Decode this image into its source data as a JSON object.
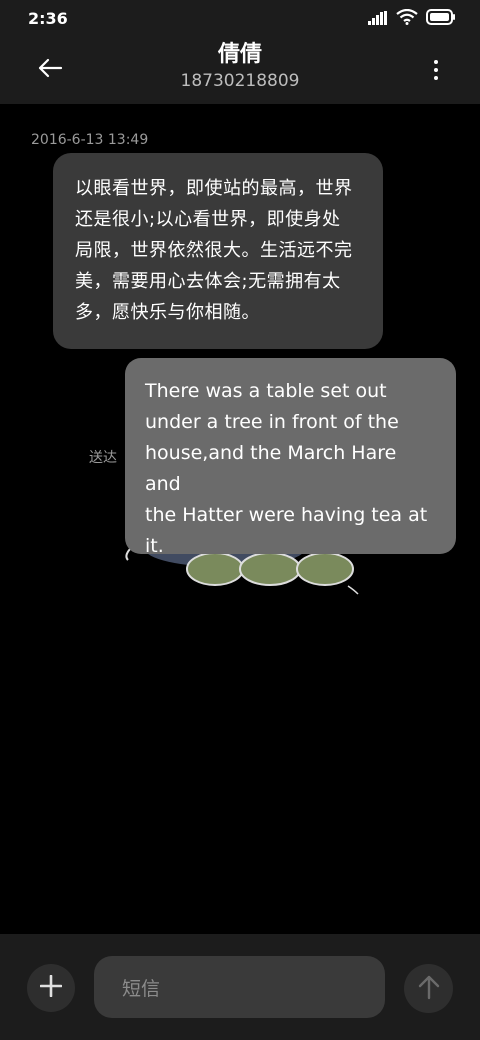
{
  "status_bar": {
    "time": "2:36",
    "icons": [
      "signal-icon",
      "wifi-icon",
      "battery-icon"
    ]
  },
  "header": {
    "contact_name": "倩倩",
    "contact_number": "18730218809",
    "back_icon": "back-arrow-icon",
    "menu_icon": "more-vertical-icon"
  },
  "conversation": {
    "timestamp": "2016-6-13 13:49",
    "messages": [
      {
        "direction": "incoming",
        "lines": [
          "以眼看世界，即使站的最高，世界",
          "还是很小;以心看世界，即使身处",
          "局限，世界依然很大。生活远不完",
          "美，需要用心去体会;无需拥有太",
          "多，愿快乐与你相随。"
        ]
      },
      {
        "direction": "outgoing",
        "lines": [
          "There was a table set out",
          "under a tree in front of the",
          "house,and the March Hare and",
          "the Hatter were having tea at",
          "it."
        ]
      }
    ],
    "delivery_status": "送达"
  },
  "composer": {
    "placeholder": "短信",
    "add_icon": "plus-icon",
    "send_icon": "send-arrow-up-icon"
  },
  "colors": {
    "background": "#000000",
    "bar_background": "#1c1c1c",
    "incoming_bubble": "#3a3a3a",
    "outgoing_bubble": "#6b6b6b"
  }
}
